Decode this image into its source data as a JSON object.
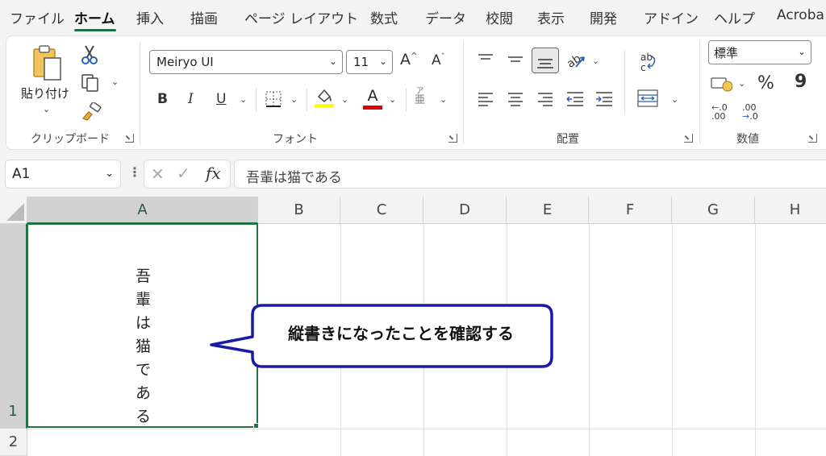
{
  "menu": {
    "tabs": [
      "ファイル",
      "ホーム",
      "挿入",
      "描画",
      "ページ レイアウト",
      "数式",
      "データ",
      "校閲",
      "表示",
      "開発",
      "アドイン",
      "ヘルプ",
      "Acroba"
    ],
    "active_index": 1
  },
  "ribbon": {
    "clipboard": {
      "paste_label": "貼り付け",
      "group_label": "クリップボード"
    },
    "font": {
      "font_name": "Meiryo UI",
      "font_size": "11",
      "bold": "B",
      "italic": "I",
      "underline": "U",
      "font_color_glyph": "A",
      "increase_font": "A",
      "decrease_font": "A",
      "group_label": "フォント",
      "highlight_color": "#ffff00",
      "font_color": "#e00000"
    },
    "alignment": {
      "group_label": "配置",
      "orientation_selected": true
    },
    "number": {
      "format": "標準",
      "percent": "%",
      "comma": "9",
      "increase_decimal_top": ".0",
      "increase_decimal_bottom": ".00",
      "decrease_decimal_top": ".00",
      "decrease_decimal_bottom": ".0",
      "group_label": "数値"
    }
  },
  "formula_bar": {
    "name_box": "A1",
    "fx_label": "fx",
    "content": "吾輩は猫である"
  },
  "sheet": {
    "columns": [
      "A",
      "B",
      "C",
      "D",
      "E",
      "F",
      "G",
      "H"
    ],
    "rows": [
      "1",
      "2"
    ],
    "selected_cell": "A1",
    "a1_chars": [
      "吾",
      "輩",
      "は",
      "猫",
      "で",
      "あ",
      "る"
    ]
  },
  "callout": {
    "text": "縦書きになったことを確認する",
    "border_color": "#1a1aa8"
  },
  "colors": {
    "accent_green": "#217346",
    "tab_underline": "#1e7145"
  }
}
